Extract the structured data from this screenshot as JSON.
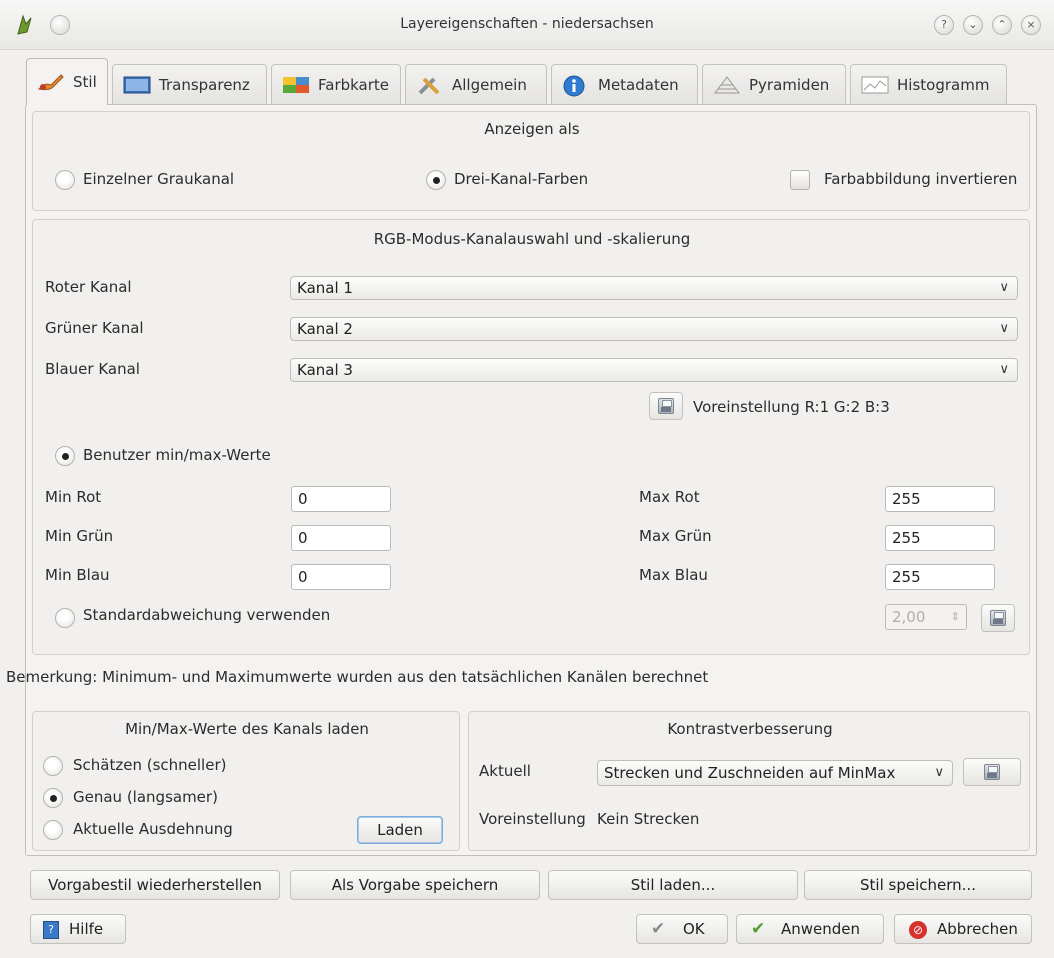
{
  "window": {
    "title": "Layereigenschaften - niedersachsen"
  },
  "tabs": [
    {
      "label": "Stil",
      "icon": "brush-icon"
    },
    {
      "label": "Transparenz",
      "icon": "transparency-icon"
    },
    {
      "label": "Farbkarte",
      "icon": "colormap-icon"
    },
    {
      "label": "Allgemein",
      "icon": "tools-icon"
    },
    {
      "label": "Metadaten",
      "icon": "info-icon"
    },
    {
      "label": "Pyramiden",
      "icon": "pyramid-icon"
    },
    {
      "label": "Histogramm",
      "icon": "histogram-icon"
    }
  ],
  "display_as": {
    "heading": "Anzeigen als",
    "single_gray": "Einzelner Graukanal",
    "three_band": "Drei-Kanal-Farben",
    "invert": "Farbabbildung invertieren"
  },
  "rgb": {
    "heading": "RGB-Modus-Kanalauswahl und -skalierung",
    "red_label": "Roter Kanal",
    "red_value": "Kanal 1",
    "green_label": "Grüner Kanal",
    "green_value": "Kanal 2",
    "blue_label": "Blauer Kanal",
    "blue_value": "Kanal 3",
    "default_label": "Voreinstellung R:1 G:2 B:3",
    "user_minmax": "Benutzer min/max-Werte",
    "min_red_label": "Min Rot",
    "min_red": "0",
    "min_green_label": "Min Grün",
    "min_green": "0",
    "min_blue_label": "Min Blau",
    "min_blue": "0",
    "max_red_label": "Max Rot",
    "max_red": "255",
    "max_green_label": "Max Grün",
    "max_green": "255",
    "max_blue_label": "Max Blau",
    "max_blue": "255",
    "stddev_label": "Standardabweichung verwenden",
    "stddev_value": "2,00"
  },
  "note": "Bemerkung: Minimum- und Maximumwerte wurden aus den tatsächlichen Kanälen berechnet",
  "load_minmax": {
    "heading": "Min/Max-Werte des Kanals laden",
    "estimate": "Schätzen (schneller)",
    "exact": "Genau (langsamer)",
    "extent": "Aktuelle Ausdehnung",
    "load_button": "Laden"
  },
  "contrast": {
    "heading": "Kontrastverbesserung",
    "current_label": "Aktuell",
    "current_value": "Strecken und Zuschneiden auf MinMax",
    "default_label": "Voreinstellung",
    "default_value": "Kein Strecken"
  },
  "style_buttons": {
    "restore": "Vorgabestil wiederherstellen",
    "save_default": "Als Vorgabe speichern",
    "load_style": "Stil laden...",
    "save_style": "Stil speichern..."
  },
  "footer": {
    "help": "Hilfe",
    "ok": "OK",
    "apply": "Anwenden",
    "cancel": "Abbrechen"
  },
  "window_buttons": {
    "help": "?",
    "min": "⌄",
    "max": "⌃",
    "close": "×"
  }
}
